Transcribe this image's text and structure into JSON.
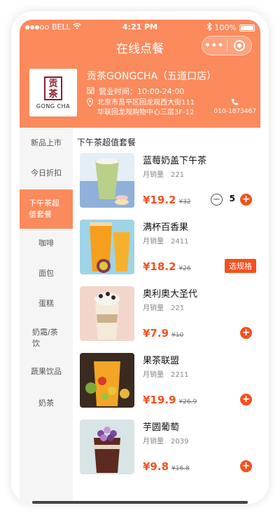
{
  "status_bar": {
    "carrier": "BELL",
    "time": "4:21 PM",
    "battery": "100%"
  },
  "nav": {
    "title": "在线点餐",
    "more_icon": "more-dots-icon",
    "close_icon": "target-circle-icon"
  },
  "shop": {
    "logo_text": "贡茶",
    "logo_brand": "GONG CHA",
    "name": "贡茶GONGCHA（五道口店）",
    "hours": "营业时间：10:00-24:00",
    "address_line1": "北京市昌平区回龙观西大街111",
    "address_line2": "华联回龙观购物中心三层3F-12",
    "phone": "010-1873467"
  },
  "categories": [
    {
      "label": "新品上市",
      "active": false
    },
    {
      "label": "今日折扣",
      "active": false
    },
    {
      "label": "下午茶超值套餐",
      "active": true
    },
    {
      "label": "咖啡",
      "active": false
    },
    {
      "label": "面包",
      "active": false
    },
    {
      "label": "蛋糕",
      "active": false
    },
    {
      "label": "奶霜/茶饮",
      "active": false
    },
    {
      "label": "蔬果饮品",
      "active": false
    },
    {
      "label": "奶茶",
      "active": false
    }
  ],
  "section_title": "下午茶超值套餐",
  "products": [
    {
      "name": "蓝莓奶盖下午茶",
      "sales": "月销量　221",
      "price": "¥19.2",
      "old_price": "¥32",
      "quantity": "5"
    },
    {
      "name": "满杯百香果",
      "sales": "月销量　2411",
      "price": "¥18.2",
      "old_price": "¥26",
      "action": "选规格"
    },
    {
      "name": "奥利奥大圣代",
      "sales": "月销量　221",
      "price": "¥7.9",
      "old_price": "¥10"
    },
    {
      "name": "果茶联盟",
      "sales": "月销量　2211",
      "price": "¥19.9",
      "old_price": "¥26.9"
    },
    {
      "name": "芋圆葡萄",
      "sales": "月销量　2039",
      "price": "¥9.8",
      "old_price": "¥16.8"
    }
  ],
  "colors": {
    "accent": "#fb8a5c",
    "price": "#f4511e"
  }
}
